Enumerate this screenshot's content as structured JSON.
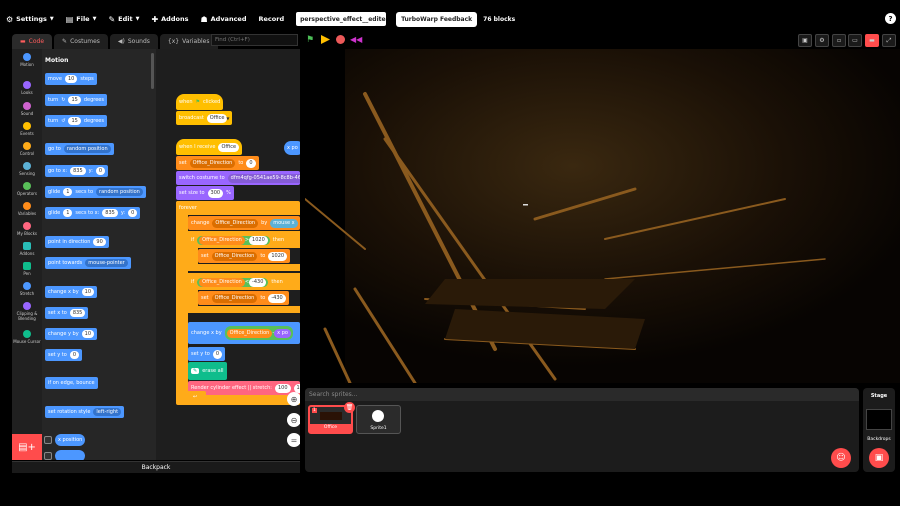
{
  "menu": {
    "settings": "Settings",
    "file": "File",
    "edit": "Edit",
    "addons": "Addons",
    "advanced": "Advanced",
    "record": "Record",
    "project_title": "perspective_effect__edited...",
    "feedback": "TurboWarp Feedback",
    "block_count": "76 blocks",
    "help": "?"
  },
  "tabs": {
    "code": "Code",
    "costumes": "Costumes",
    "sounds": "Sounds",
    "variables": "Variables"
  },
  "find_placeholder": "Find (Ctrl+F)",
  "categories": [
    {
      "label": "Motion",
      "color": "#4c97ff"
    },
    {
      "label": "Looks",
      "color": "#9966ff"
    },
    {
      "label": "Sound",
      "color": "#cf63cf"
    },
    {
      "label": "Events",
      "color": "#ffbf00"
    },
    {
      "label": "Control",
      "color": "#ffab19"
    },
    {
      "label": "Sensing",
      "color": "#5cb1d6"
    },
    {
      "label": "Operators",
      "color": "#59c059"
    },
    {
      "label": "Variables",
      "color": "#ff8c1a"
    },
    {
      "label": "My Blocks",
      "color": "#ff6680"
    },
    {
      "label": "Addons",
      "color": "#29beb8"
    },
    {
      "label": "Pen",
      "color": "#0fbd8c"
    },
    {
      "label": "Stretch",
      "color": "#4c97ff"
    },
    {
      "label": "Clipping & Blending",
      "color": "#9966ff"
    },
    {
      "label": "Mouse Cursor",
      "color": "#0fbd8c"
    }
  ],
  "palette": {
    "title": "Motion",
    "move": {
      "a": "move",
      "v": "10",
      "b": "steps"
    },
    "turn_right": {
      "a": "turn",
      "v": "15",
      "b": "degrees"
    },
    "turn_left": {
      "a": "turn",
      "v": "15",
      "b": "degrees"
    },
    "goto": {
      "a": "go to",
      "d": "random position"
    },
    "goto_xy": {
      "a": "go to x:",
      "x": "835",
      "b": "y:",
      "y": "0"
    },
    "glide_to": {
      "a": "glide",
      "v": "1",
      "b": "secs to",
      "d": "random position"
    },
    "glide_xy": {
      "a": "glide",
      "v": "1",
      "b": "secs to x:",
      "x": "835",
      "c": "y:",
      "y": "0"
    },
    "point_dir": {
      "a": "point in direction",
      "v": "90"
    },
    "point_towards": {
      "a": "point towards",
      "d": "mouse-pointer"
    },
    "change_x": {
      "a": "change x by",
      "v": "10"
    },
    "set_x": {
      "a": "set x to",
      "v": "835"
    },
    "change_y": {
      "a": "change y by",
      "v": "10"
    },
    "set_y": {
      "a": "set y to",
      "v": "0"
    },
    "bounce": "if on edge, bounce",
    "rotation": {
      "a": "set rotation style",
      "d": "left-right"
    },
    "x_position": "x position"
  },
  "script": {
    "when_flag": "when",
    "clicked": "clicked",
    "broadcast": "broadcast",
    "broadcast_msg": "Office",
    "when_receive": "when I receive",
    "receive_msg": "Office",
    "set_var_a": "set",
    "set_var_name": "Office_Direction",
    "set_var_to": "to",
    "set_var_val": "0",
    "switch_costume": "switch costume to",
    "costume_name": "dfm4qfg-0541ae59-8c8b-466...",
    "set_size": "set size to",
    "size_val": "300",
    "size_pct": "%",
    "forever": "forever",
    "change_var": "change",
    "change_var_name": "Office_Direction",
    "change_by": "by",
    "mouse_x": "mouse x",
    "if1": "if",
    "if1_var": "Office_Direction",
    "if1_op": ">",
    "if1_val": "1020",
    "then1": "then",
    "set1": "set",
    "set1_var": "Office_Direction",
    "set1_to": "to",
    "set1_val": "1020",
    "if2": "if",
    "if2_var": "Office_Direction",
    "if2_op": "<",
    "if2_val": "-430",
    "then2": "then",
    "set2": "set",
    "set2_var": "Office_Direction",
    "set2_to": "to",
    "set2_val": "-430",
    "change_x": "change x by",
    "cx_var": "Office_Direction",
    "cx_op": "-",
    "cx_rhs": "x po",
    "set_y": "set y to",
    "set_y_val": "0",
    "erase_all": "erase all",
    "render": "Render cylinder effect || stretch:",
    "render_a": "100",
    "render_b": "100",
    "receive_partial": "x po"
  },
  "backpack": "Backpack",
  "sprites": {
    "search_placeholder": "Search sprites...",
    "items": [
      {
        "num": "1",
        "name": "Office"
      },
      {
        "name": "Sprite1"
      }
    ]
  },
  "stage_pane": {
    "label": "Stage",
    "backdrops": "Backdrops"
  }
}
